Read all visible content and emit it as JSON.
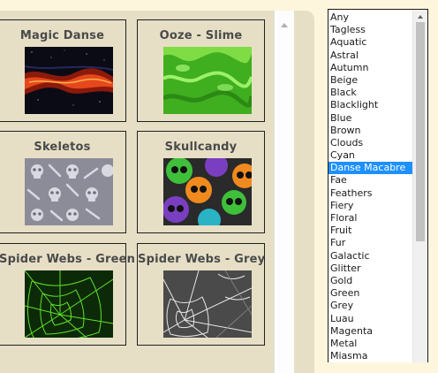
{
  "gallery": {
    "cards": [
      {
        "title": "Magic Danse",
        "image": "magic-danse-swatch"
      },
      {
        "title": "Ooze - Slime",
        "image": "ooze-slime-swatch"
      },
      {
        "title": "Skeletos",
        "image": "skeletos-swatch"
      },
      {
        "title": "Skullcandy",
        "image": "skullcandy-swatch"
      },
      {
        "title": "Spider Webs - Green",
        "image": "spider-webs-green-swatch"
      },
      {
        "title": "Spider Webs - Grey",
        "image": "spider-webs-grey-swatch"
      }
    ]
  },
  "category_list": {
    "selected": "Danse Macabre",
    "options": [
      "Any",
      "Tagless",
      "Aquatic",
      "Astral",
      "Autumn",
      "Beige",
      "Black",
      "Blacklight",
      "Blue",
      "Brown",
      "Clouds",
      "Cyan",
      "Danse Macabre",
      "Fae",
      "Feathers",
      "Fiery",
      "Floral",
      "Fruit",
      "Fur",
      "Galactic",
      "Glitter",
      "Gold",
      "Green",
      "Grey",
      "Luau",
      "Magenta",
      "Metal",
      "Miasma"
    ],
    "selected_color": "#1e90ff"
  }
}
